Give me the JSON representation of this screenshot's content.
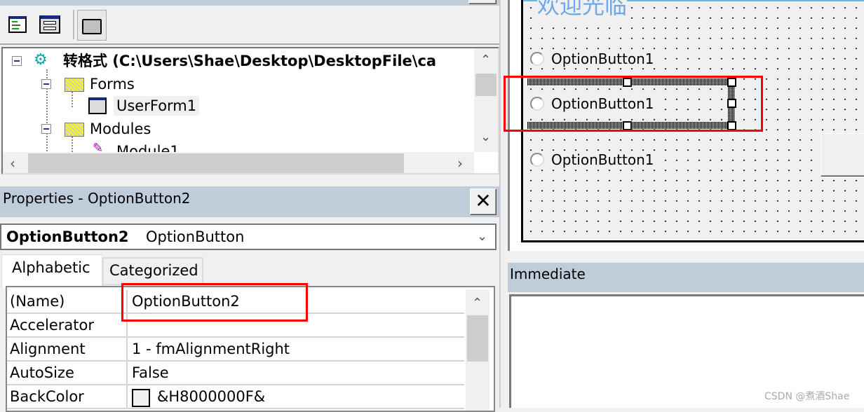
{
  "project_explorer": {
    "toolbar": [
      {
        "icon": "view-code-icon",
        "label": ""
      },
      {
        "icon": "view-object-icon",
        "label": ""
      },
      {
        "icon": "toggle-folders-icon",
        "label": ""
      }
    ],
    "tree": [
      {
        "icon": "vba-project-icon",
        "label": "转格式 (C:\\Users\\Shae\\Desktop\\DesktopFile\\ca",
        "bold": true
      },
      {
        "icon": "folder-icon",
        "label": "Forms"
      },
      {
        "icon": "userform-icon",
        "label": "UserForm1",
        "selected": true
      },
      {
        "icon": "folder-icon",
        "label": "Modules"
      },
      {
        "icon": "module-icon",
        "label": "Module1"
      }
    ]
  },
  "properties": {
    "title": "Properties - OptionButton2",
    "close_label": "✕",
    "object_name": "OptionButton2",
    "object_type": "OptionButton",
    "tabs": [
      {
        "label": "Alphabetic",
        "active": true
      },
      {
        "label": "Categorized",
        "active": false
      }
    ],
    "rows": [
      {
        "name": "(Name)",
        "value": "OptionButton2"
      },
      {
        "name": "Accelerator",
        "value": ""
      },
      {
        "name": "Alignment",
        "value": "1 - fmAlignmentRight"
      },
      {
        "name": "AutoSize",
        "value": "False"
      },
      {
        "name": "BackColor",
        "value": "&H8000000F&",
        "swatch": "#f0f0f0"
      }
    ]
  },
  "designer": {
    "form_caption": "欢迎光临",
    "option_buttons": [
      {
        "label": "OptionButton1",
        "selected": false
      },
      {
        "label": "OptionButton1",
        "selected": true
      },
      {
        "label": "OptionButton1",
        "selected": false
      }
    ]
  },
  "immediate": {
    "title": "Immediate",
    "content": ""
  },
  "watermark": "CSDN @煮酒Shae",
  "colors": {
    "panel_header": "#bfcddb",
    "highlight": "#ff0000",
    "caption_text": "#6fa8e8"
  }
}
